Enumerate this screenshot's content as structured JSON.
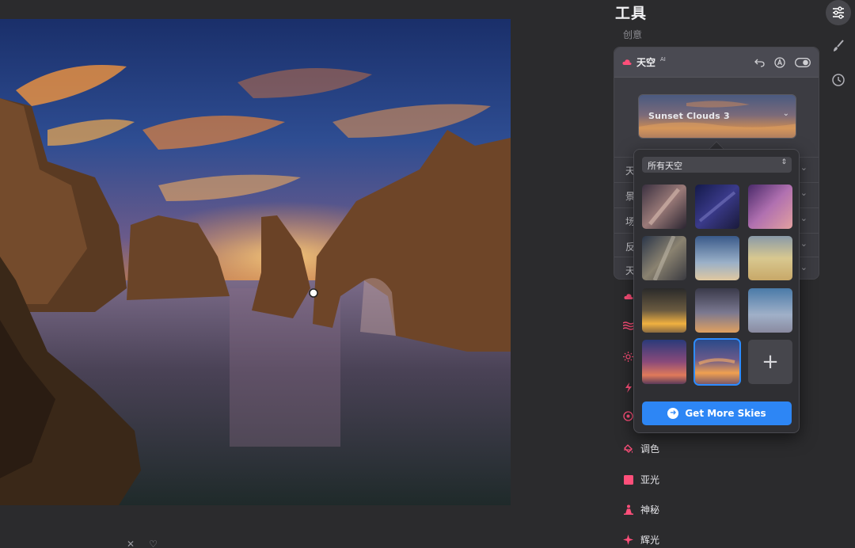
{
  "header": {
    "title": "工具",
    "section": "创意"
  },
  "sky_panel": {
    "title": "天空",
    "badge": "AI",
    "preset": {
      "label": "Sunset Clouds 3"
    },
    "rows": [
      {
        "label": "天"
      },
      {
        "label": "景"
      },
      {
        "label": "场"
      },
      {
        "label": "反"
      },
      {
        "label": "天"
      }
    ]
  },
  "popover": {
    "select_value": "所有天空",
    "thumbnails": [
      {
        "name": "milky-way-warm"
      },
      {
        "name": "night-blue"
      },
      {
        "name": "galaxy-purple"
      },
      {
        "name": "milky-way-rocks"
      },
      {
        "name": "blue-clouds"
      },
      {
        "name": "golden-haze"
      },
      {
        "name": "dark-sunset"
      },
      {
        "name": "dusk-clouds"
      },
      {
        "name": "blue-cumulus"
      },
      {
        "name": "purple-sunset"
      },
      {
        "name": "sunset-clouds-3",
        "selected": true
      },
      {
        "name": "add-sky"
      }
    ],
    "get_more_label": "Get More Skies"
  },
  "tools": [
    {
      "label": "",
      "icon": "cloud-icon",
      "color": "#ff4f7a"
    },
    {
      "label": "",
      "icon": "waves-icon",
      "color": "#ff4f7a"
    },
    {
      "label": "",
      "icon": "sun-icon",
      "color": "#ff4f7a"
    },
    {
      "label": "",
      "icon": "lightning-icon",
      "color": "#ff4f7a"
    },
    {
      "label": "",
      "icon": "flower-icon",
      "color": "#ff4f7a"
    },
    {
      "label": "调色",
      "icon": "paint-bucket-icon",
      "color": "#ff4f7a"
    },
    {
      "label": "亚光",
      "icon": "square-icon",
      "color": "#ff4f7a"
    },
    {
      "label": "神秘",
      "icon": "figure-icon",
      "color": "#ff4f7a"
    },
    {
      "label": "辉光",
      "icon": "sparkle-icon",
      "color": "#ff4f7a"
    }
  ],
  "rail": [
    {
      "icon": "sliders-icon",
      "active": true
    },
    {
      "icon": "brush-icon",
      "active": false
    },
    {
      "icon": "history-clock-icon",
      "active": false
    }
  ],
  "bottom": {
    "close_glyph": "✕",
    "favorite_glyph": "♡"
  },
  "colors": {
    "accent": "#2d86f5",
    "tool_pink": "#ff4f7a",
    "bg": "#2b2b2d"
  }
}
